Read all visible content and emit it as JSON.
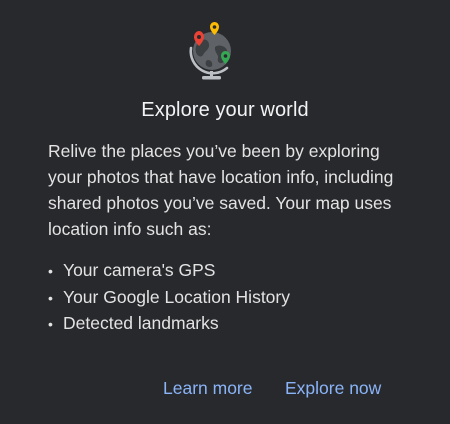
{
  "dialog": {
    "illustration_icon": "globe-with-location-pins-icon",
    "title": "Explore your world",
    "body": "Relive the places you’ve been by exploring your photos that have location info, including shared photos you’ve saved. Your map uses location info such as:",
    "bullets": [
      "Your camera's GPS",
      "Your Google Location History",
      "Detected landmarks"
    ],
    "bullet_glyph": "•",
    "actions": {
      "learn_more": "Learn more",
      "explore_now": "Explore now"
    }
  },
  "colors": {
    "background": "#28292d",
    "text": "#e3e3e3",
    "accent": "#8ab4f8",
    "globe": "#5f6368",
    "pin_red": "#ea4335",
    "pin_yellow": "#fbbc04",
    "pin_green": "#34a853"
  }
}
